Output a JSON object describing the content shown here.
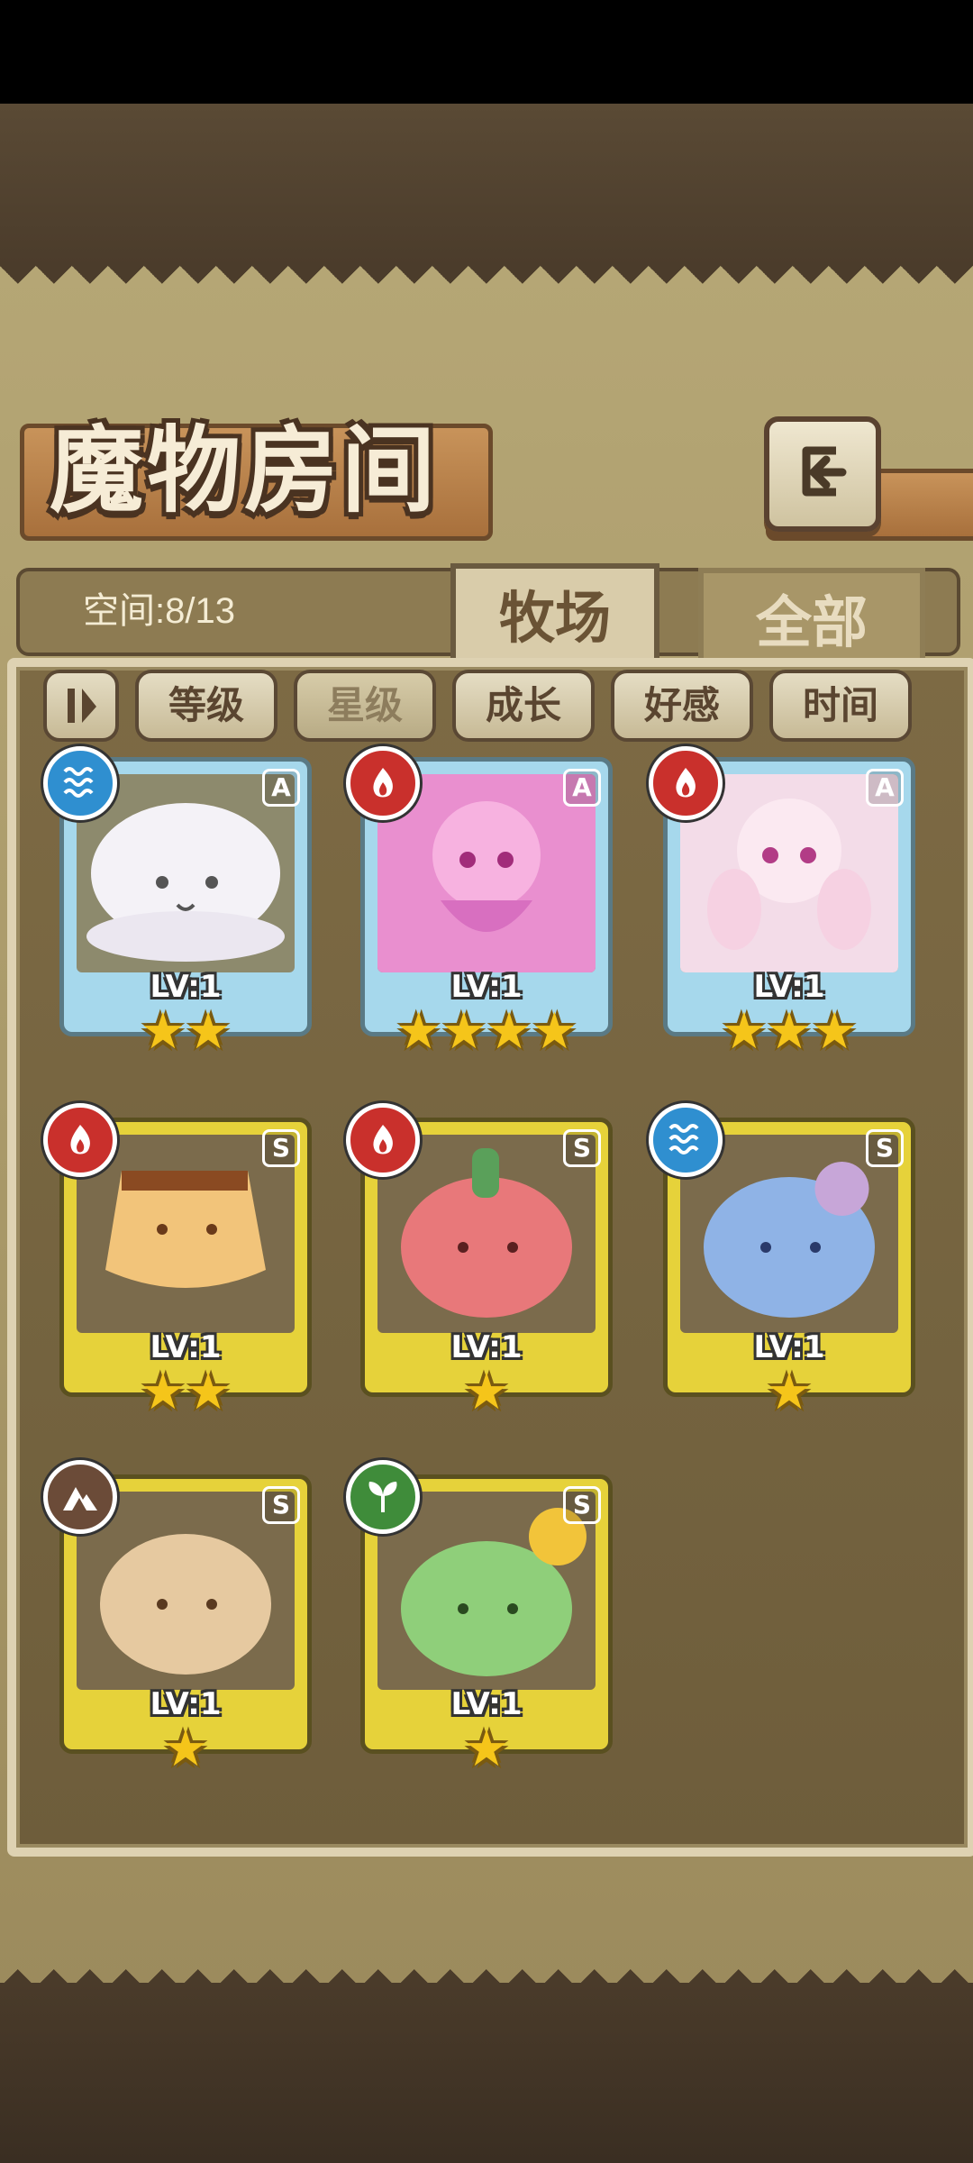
{
  "title": "魔物房间",
  "space_label": "空间:8/13",
  "tabs": [
    {
      "label": "牧场",
      "active": true
    },
    {
      "label": "全部",
      "active": false
    }
  ],
  "sort_buttons": [
    "等级",
    "星级",
    "成长",
    "好感",
    "时间"
  ],
  "active_sort": "星级",
  "monsters": [
    {
      "element": "water",
      "rank": "A",
      "level": "LV:1",
      "stars": "★★"
    },
    {
      "element": "fire",
      "rank": "A",
      "level": "LV:1",
      "stars": "★★★★"
    },
    {
      "element": "fire",
      "rank": "A",
      "level": "LV:1",
      "stars": "★★★"
    },
    {
      "element": "fire",
      "rank": "S",
      "level": "LV:1",
      "stars": "★★"
    },
    {
      "element": "fire",
      "rank": "S",
      "level": "LV:1",
      "stars": "★"
    },
    {
      "element": "water",
      "rank": "S",
      "level": "LV:1",
      "stars": "★"
    },
    {
      "element": "earth",
      "rank": "S",
      "level": "LV:1",
      "stars": "★"
    },
    {
      "element": "wood",
      "rank": "S",
      "level": "LV:1",
      "stars": "★"
    }
  ],
  "colors": {
    "rank_a_frame": "#a6d8ec",
    "rank_s_frame": "#e6d23a",
    "water": "#2f8fd0",
    "fire": "#c9302c",
    "earth": "#6b4b38",
    "wood": "#3f8c3a"
  }
}
